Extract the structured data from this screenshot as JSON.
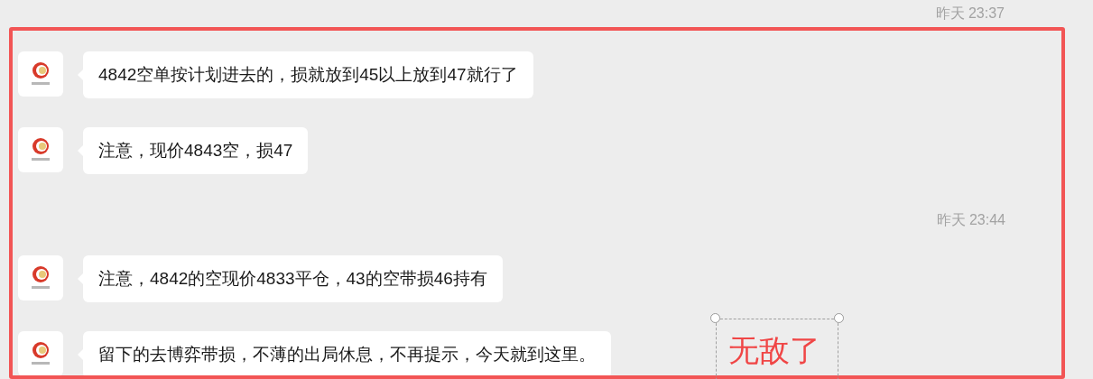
{
  "header_time": "昨天 23:37",
  "items": [
    {
      "kind": "message",
      "text": "4842空单按计划进去的，损就放到45以上放到47就行了"
    },
    {
      "kind": "message",
      "text": "注意，现价4843空，损47"
    },
    {
      "kind": "time",
      "text": "昨天 23:44"
    },
    {
      "kind": "message",
      "text": "注意，4842的空现价4833平仓，43的空带损46持有"
    },
    {
      "kind": "message",
      "text": "留下的去博弈带损，不薄的出局休息，不再提示，今天就到这里。"
    }
  ],
  "annotation": {
    "text": "无敌了"
  }
}
